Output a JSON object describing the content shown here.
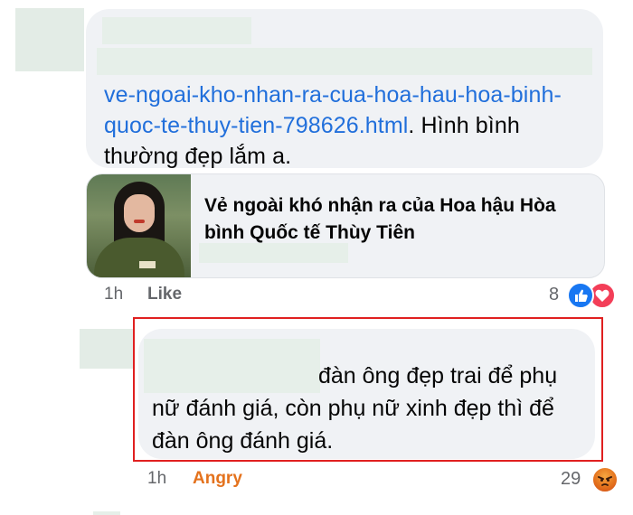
{
  "comment1": {
    "link_text": "ve-ngoai-kho-nhan-ra-cua-hoa-hau-hoa-binh-quoc-te-thuy-tien-798626.html",
    "text_after": ". Hình bình thường đẹp lắm a.",
    "preview": {
      "title": "Vẻ ngoài khó nhận ra của Hoa hậu Hòa bình Quốc tế Thùy Tiên"
    },
    "time": "1h",
    "like_label": "Like",
    "reaction_count": "8",
    "reactions": [
      "like-reaction-icon",
      "love-reaction-icon"
    ]
  },
  "comment2": {
    "text": "đàn ông đẹp trai để phụ nữ đánh giá, còn phụ nữ xinh đẹp thì để đàn ông đánh giá.",
    "time": "1h",
    "reaction_label": "Angry",
    "reaction_count": "29",
    "reactions": [
      "angry-reaction-icon"
    ]
  },
  "colors": {
    "link": "#216fdb",
    "bubble": "#f0f2f5",
    "highlight": "#e02020",
    "angry": "#e4721d",
    "like_blue": "#1877f2",
    "love_red": "#f33e58"
  }
}
